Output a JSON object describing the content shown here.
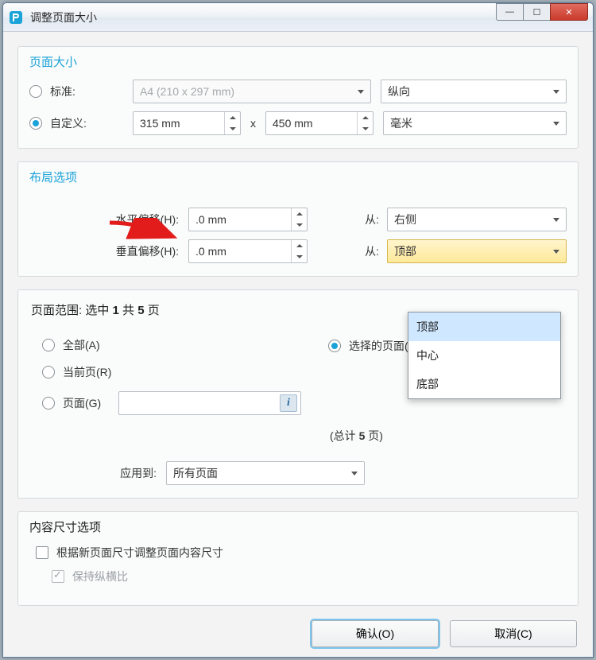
{
  "window": {
    "title": "调整页面大小"
  },
  "pagesize": {
    "group_title": "页面大小",
    "standard_label": "标准:",
    "custom_label": "自定义:",
    "preset_value": "A4 (210 x 297 mm)",
    "orientation_value": "纵向",
    "width_value": "315 mm",
    "height_value": "450 mm",
    "x_label": "x",
    "unit_value": "毫米"
  },
  "layout": {
    "group_title": "布局选项",
    "hoff_label": "水平偏移(H):",
    "voff_label": "垂直偏移(H):",
    "hoff_value": ".0 mm",
    "voff_value": ".0 mm",
    "from_label": "从:",
    "hfrom_value": "右侧",
    "vfrom_value": "顶部",
    "dropdown_options": [
      "顶部",
      "中心",
      "底部"
    ]
  },
  "range": {
    "title_prefix": "页面范围: 选中 ",
    "sel_count": "1",
    "title_mid": " 共 ",
    "total_count": "5",
    "title_suffix": " 页",
    "all_label": "全部(A)",
    "selected_label": "选择的页面(S)",
    "current_label": "当前页(R)",
    "pages_label": "页面(G)",
    "pages_value": "",
    "total_prefix": "(总计 ",
    "total_suffix": " 页)",
    "apply_label": "应用到:",
    "apply_value": "所有页面"
  },
  "contentsize": {
    "group_title": "内容尺寸选项",
    "resize_label": "根据新页面尺寸调整页面内容尺寸",
    "aspect_label": "保持纵横比"
  },
  "buttons": {
    "ok": "确认(O)",
    "cancel": "取消(C)"
  }
}
